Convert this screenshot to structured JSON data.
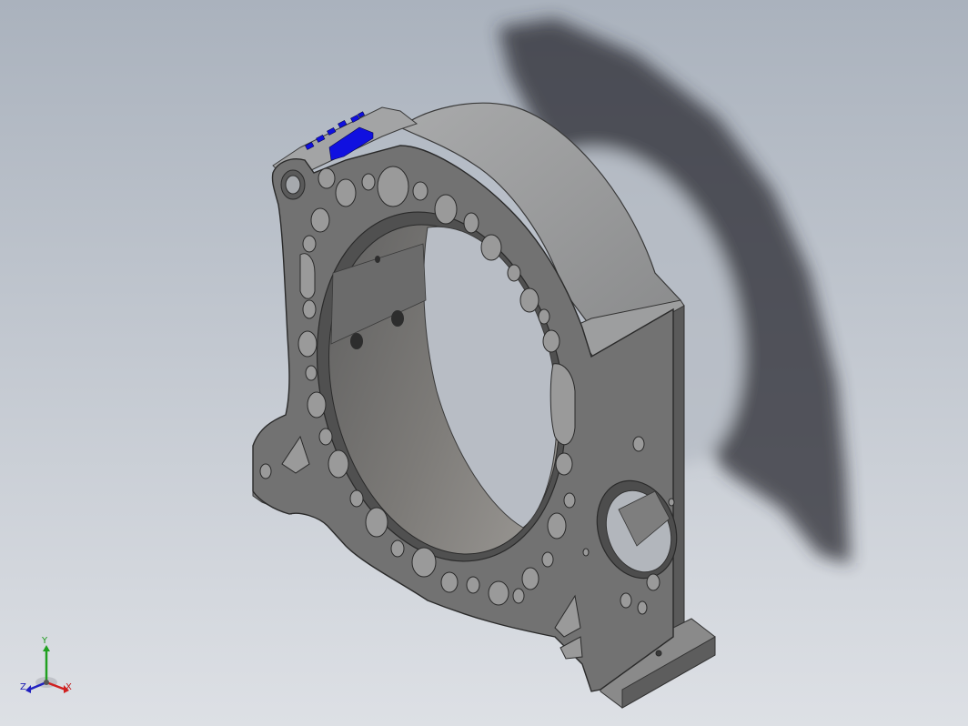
{
  "viewport": {
    "background_top": "#aeb5bf",
    "background_bottom": "#dcdfe4",
    "model": "rotor-housing-part",
    "part_color": "#6e6e6e",
    "highlight_color": "#1010e0"
  },
  "triad": {
    "x_label": "X",
    "y_label": "Y",
    "z_label": "Z",
    "x_color": "#d02020",
    "y_color": "#20a020",
    "z_color": "#2020c0"
  }
}
